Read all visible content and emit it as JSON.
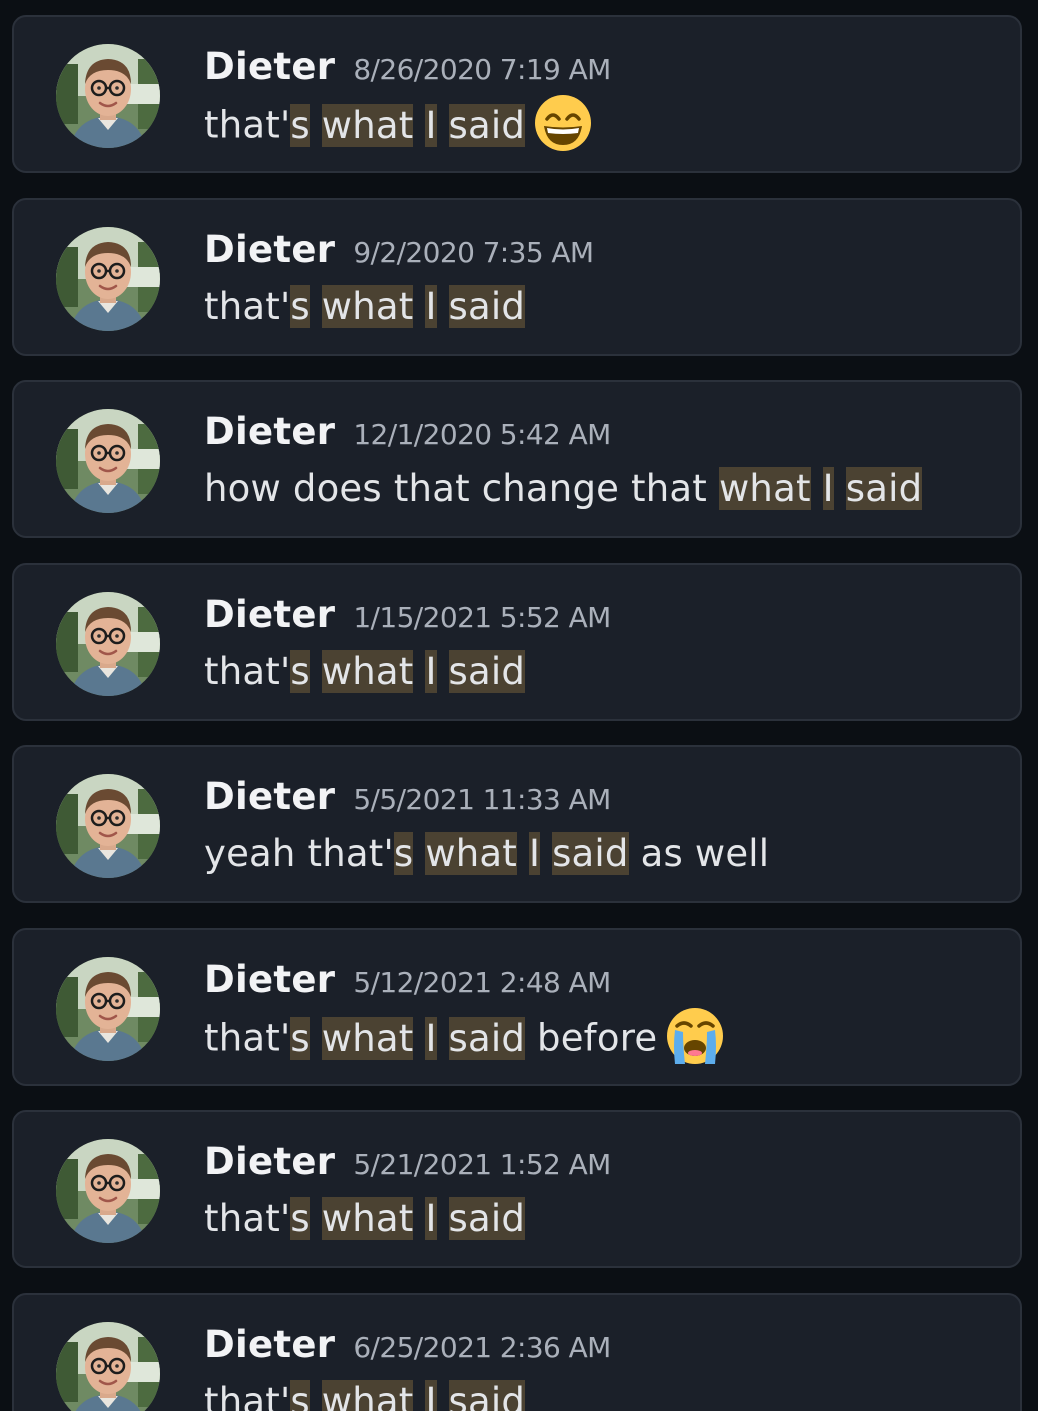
{
  "messages": [
    {
      "author": "Dieter",
      "timestamp": "8/26/2020 7:19 AM",
      "segments": [
        {
          "t": "that'",
          "h": false
        },
        {
          "t": "s",
          "h": true
        },
        {
          "t": " ",
          "h": false
        },
        {
          "t": "what",
          "h": true
        },
        {
          "t": " ",
          "h": false
        },
        {
          "t": "I",
          "h": true
        },
        {
          "t": " ",
          "h": false
        },
        {
          "t": "said",
          "h": true
        }
      ],
      "emoji": "grinning-smiling-eyes"
    },
    {
      "author": "Dieter",
      "timestamp": "9/2/2020 7:35 AM",
      "segments": [
        {
          "t": "that'",
          "h": false
        },
        {
          "t": "s",
          "h": true
        },
        {
          "t": " ",
          "h": false
        },
        {
          "t": "what",
          "h": true
        },
        {
          "t": " ",
          "h": false
        },
        {
          "t": "I",
          "h": true
        },
        {
          "t": " ",
          "h": false
        },
        {
          "t": "said",
          "h": true
        }
      ],
      "emoji": ""
    },
    {
      "author": "Dieter",
      "timestamp": "12/1/2020 5:42 AM",
      "segments": [
        {
          "t": "how does that change that ",
          "h": false
        },
        {
          "t": "what",
          "h": true
        },
        {
          "t": " ",
          "h": false
        },
        {
          "t": "I",
          "h": true
        },
        {
          "t": " ",
          "h": false
        },
        {
          "t": "said",
          "h": true
        }
      ],
      "emoji": ""
    },
    {
      "author": "Dieter",
      "timestamp": "1/15/2021 5:52 AM",
      "segments": [
        {
          "t": "that'",
          "h": false
        },
        {
          "t": "s",
          "h": true
        },
        {
          "t": " ",
          "h": false
        },
        {
          "t": "what",
          "h": true
        },
        {
          "t": " ",
          "h": false
        },
        {
          "t": "I",
          "h": true
        },
        {
          "t": " ",
          "h": false
        },
        {
          "t": "said",
          "h": true
        }
      ],
      "emoji": ""
    },
    {
      "author": "Dieter",
      "timestamp": "5/5/2021 11:33 AM",
      "segments": [
        {
          "t": "yeah that'",
          "h": false
        },
        {
          "t": "s",
          "h": true
        },
        {
          "t": " ",
          "h": false
        },
        {
          "t": "what",
          "h": true
        },
        {
          "t": " ",
          "h": false
        },
        {
          "t": "I",
          "h": true
        },
        {
          "t": " ",
          "h": false
        },
        {
          "t": "said",
          "h": true
        },
        {
          "t": " as well",
          "h": false
        }
      ],
      "emoji": ""
    },
    {
      "author": "Dieter",
      "timestamp": "5/12/2021 2:48 AM",
      "segments": [
        {
          "t": "that'",
          "h": false
        },
        {
          "t": "s",
          "h": true
        },
        {
          "t": " ",
          "h": false
        },
        {
          "t": "what",
          "h": true
        },
        {
          "t": " ",
          "h": false
        },
        {
          "t": "I",
          "h": true
        },
        {
          "t": " ",
          "h": false
        },
        {
          "t": "said",
          "h": true
        },
        {
          "t": " before",
          "h": false
        }
      ],
      "emoji": "loudly-crying-face"
    },
    {
      "author": "Dieter",
      "timestamp": "5/21/2021 1:52 AM",
      "segments": [
        {
          "t": "that'",
          "h": false
        },
        {
          "t": "s",
          "h": true
        },
        {
          "t": " ",
          "h": false
        },
        {
          "t": "what",
          "h": true
        },
        {
          "t": " ",
          "h": false
        },
        {
          "t": "I",
          "h": true
        },
        {
          "t": " ",
          "h": false
        },
        {
          "t": "said",
          "h": true
        }
      ],
      "emoji": ""
    },
    {
      "author": "Dieter",
      "timestamp": "6/25/2021 2:36 AM",
      "segments": [
        {
          "t": "that'",
          "h": false
        },
        {
          "t": "s",
          "h": true
        },
        {
          "t": " ",
          "h": false
        },
        {
          "t": "what",
          "h": true
        },
        {
          "t": " ",
          "h": false
        },
        {
          "t": "I",
          "h": true
        },
        {
          "t": " ",
          "h": false
        },
        {
          "t": "said",
          "h": true
        }
      ],
      "emoji": ""
    }
  ],
  "colors": {
    "background": "#0b0f14",
    "card": "#1b2029",
    "card_border": "#2b313b",
    "highlight": "#4b4232",
    "author": "#f2f3f5",
    "timestamp": "#aab0ba",
    "message_text": "#e3e5e8"
  }
}
